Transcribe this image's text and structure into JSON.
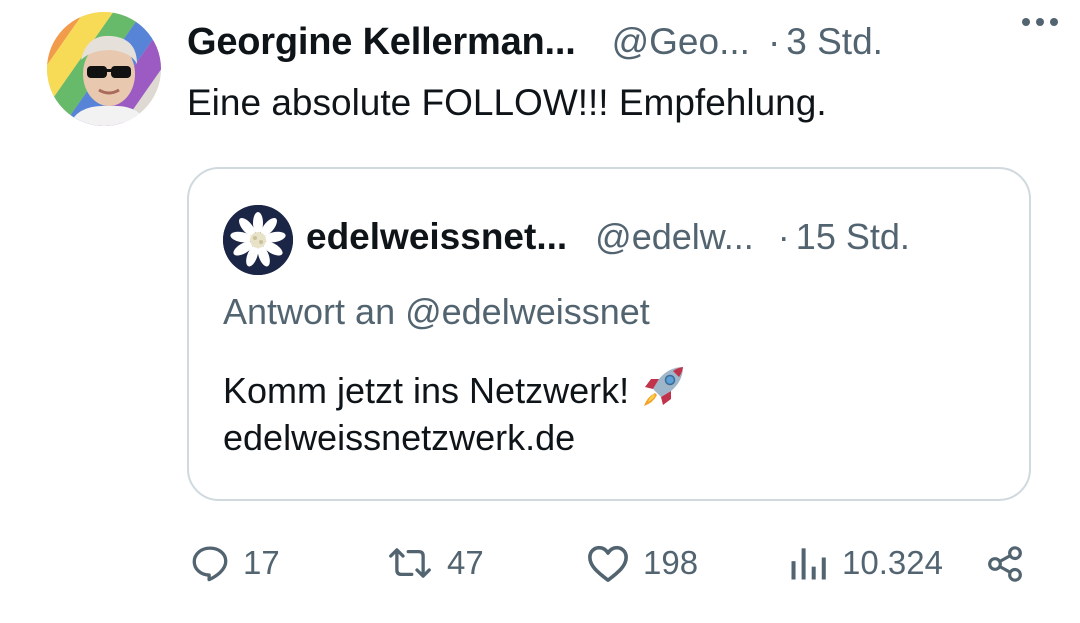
{
  "tweet": {
    "author_name": "Georgine Kellerman...",
    "author_handle": "@Geo...",
    "separator": "·",
    "time": "3 Std.",
    "text": "Eine absolute FOLLOW!!! Empfehlung.",
    "more_icon": "more-dots-icon"
  },
  "quote": {
    "author_name": "edelweissnet...",
    "author_handle": "@edelw...",
    "separator": "·",
    "time": "15 Std.",
    "reply_to": "Antwort an @edelweissnet",
    "text": "Komm jetzt ins Netzwerk!",
    "emoji": "rocket-icon",
    "link": "edelweissnetzwerk.de",
    "avatar_icon": "edelweiss-flower-icon"
  },
  "actions": {
    "reply_count": "17",
    "retweet_count": "47",
    "like_count": "198",
    "views_count": "10.324"
  },
  "colors": {
    "text_primary": "#0f1419",
    "text_secondary": "#536471",
    "border": "#cfd9de",
    "quote_avatar_bg": "#1b2545"
  }
}
